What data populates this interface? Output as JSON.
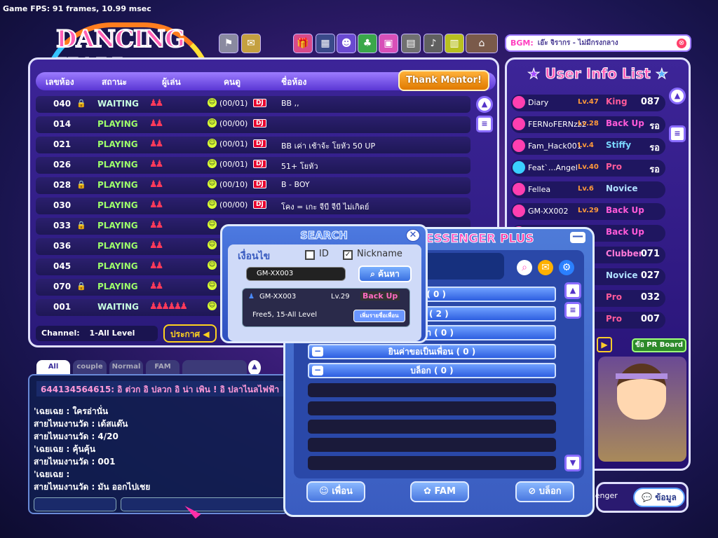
{
  "fps": "Game FPS: 91 frames, 10.99 msec",
  "logo": "DANCING HALL",
  "bgm": {
    "label": "BGM:",
    "song": "เอ๊ะ จิรากร - ไม่มีกรงกลาง",
    "close": "⊗"
  },
  "room_headers": {
    "no": "เลขห้อง",
    "status": "สถานะ",
    "players": "ผู้เล่น",
    "audience": "คนดู",
    "name": "ชื่อห้อง"
  },
  "thank_mentor": "Thank Mentor!",
  "rooms": [
    {
      "num": "040",
      "lock": "🔒",
      "status": "WAITING",
      "players": "♟♟",
      "count": "(00/01)",
      "dj": "DJ",
      "name": "BB ,,"
    },
    {
      "num": "014",
      "lock": "",
      "status": "PLAYING",
      "players": "♟♟",
      "count": "(00/00)",
      "dj": "DJ",
      "name": ""
    },
    {
      "num": "021",
      "lock": "",
      "status": "PLAYING",
      "players": "♟♟",
      "count": "(00/01)",
      "dj": "DJ",
      "name": "BB เค่า เช้าจ้ะ โยหัว 50 UP"
    },
    {
      "num": "026",
      "lock": "",
      "status": "PLAYING",
      "players": "♟♟",
      "count": "(00/01)",
      "dj": "DJ",
      "name": "51+ โยหัว"
    },
    {
      "num": "028",
      "lock": "🔒",
      "status": "PLAYING",
      "players": "♟♟",
      "count": "(00/10)",
      "dj": "DJ",
      "name": "B - BOY"
    },
    {
      "num": "030",
      "lock": "",
      "status": "PLAYING",
      "players": "♟♟",
      "count": "(00/00)",
      "dj": "DJ",
      "name": "โคง = เกะ จีบี จีบี ไม่เกิดย์"
    },
    {
      "num": "033",
      "lock": "🔒",
      "status": "PLAYING",
      "players": "♟♟",
      "count": "",
      "dj": "",
      "name": ""
    },
    {
      "num": "036",
      "lock": "",
      "status": "PLAYING",
      "players": "♟♟",
      "count": "",
      "dj": "",
      "name": ""
    },
    {
      "num": "045",
      "lock": "",
      "status": "PLAYING",
      "players": "♟♟",
      "count": "",
      "dj": "",
      "name": ""
    },
    {
      "num": "070",
      "lock": "🔒",
      "status": "PLAYING",
      "players": "♟♟",
      "count": "",
      "dj": "",
      "name": ""
    },
    {
      "num": "001",
      "lock": "",
      "status": "WAITING",
      "players": "♟♟♟♟♟♟",
      "count": "",
      "dj": "",
      "name": ""
    }
  ],
  "channel": {
    "label": "Channel:",
    "value": "1-All Level"
  },
  "announce": "ประกาศ",
  "user_title": "User Info List",
  "users": [
    {
      "name": "Diary",
      "lv": "Lv.47",
      "rank": "King",
      "pts": "087"
    },
    {
      "name": "FERNoFERNzz2",
      "lv": "Lv.28",
      "rank": "Back Up",
      "pts": "รอ"
    },
    {
      "name": "Fam_Hack001",
      "lv": "Lv.4",
      "rank": "Stiffy",
      "pts": "รอ"
    },
    {
      "name": "Feat`...Angel",
      "lv": "Lv.40",
      "rank": "Pro",
      "pts": "รอ"
    },
    {
      "name": "Fellea",
      "lv": "Lv.6",
      "rank": "Novice",
      "pts": ""
    },
    {
      "name": "GM-XX002",
      "lv": "Lv.29",
      "rank": "Back Up",
      "pts": ""
    },
    {
      "name": "",
      "lv": "",
      "rank": "Back Up",
      "pts": ""
    },
    {
      "name": "",
      "lv": "",
      "rank": "Clubber",
      "pts": "071"
    },
    {
      "name": "",
      "lv": "",
      "rank": "Novice",
      "pts": "027"
    },
    {
      "name": "",
      "lv": "",
      "rank": "Pro",
      "pts": "032"
    },
    {
      "name": "",
      "lv": "",
      "rank": "Pro",
      "pts": "007"
    }
  ],
  "pr_board": "ข้อ PR Board",
  "info_button": "ข้อมูล",
  "messenger_stub": "senger",
  "chat_tabs": [
    "All",
    "couple",
    "Normal",
    "FAM"
  ],
  "chat_head": "644134564615: อิ ต่วก อิ ปลวก อิ น่า เพิน ! อิ ปลาไนลไฟฟ้า",
  "chat_lines": [
    "'เฉยเฉย : ใครอ่านั่น",
    "สายไหมงานวัด : เด้สแด๊น",
    "สายไหมงานวัด : 4/20",
    "'เฉยเฉย : คุ้นคุ้น",
    "สายไหมงานวัด : 001",
    "'เฉยเฉย :",
    "สายไหมงานวัด : มัน ออกไปเชย"
  ],
  "messenger": {
    "title": "ESSENGER",
    "plus": "PLUS",
    "minimize": "—",
    "groups": [
      {
        "label": "น์ ( 0 )"
      },
      {
        "label": "ลน์ ( 2 )"
      },
      {
        "label": "ขอมา ( 0 )"
      },
      {
        "label": "ยินค่าขอเป็นเพื่อน ( 0 )"
      },
      {
        "label": "บล็อก ( 0 )"
      }
    ],
    "buttons": {
      "friend": "เพื่อน",
      "fam": "FAM",
      "block": "บล็อก"
    }
  },
  "search": {
    "title": "SEARCH",
    "close": "✕",
    "condition": "เงื่อนไข",
    "opt_id": "ID",
    "opt_nick": "Nickname",
    "nick_checked": "✓",
    "input_value": "GM-XX003",
    "button": "ค้นหา",
    "result": {
      "name": "GM-XX003",
      "lv": "Lv.29",
      "rank": "Back Up",
      "room": "Free5, 15-All Level",
      "add": "เพิ่มรายชื่อเพื่อน"
    }
  },
  "colors": {
    "accent": "#ff5fb4",
    "playing": "#9dff6a",
    "panel": "#3c2498",
    "messenger": "#4e7bd8"
  }
}
